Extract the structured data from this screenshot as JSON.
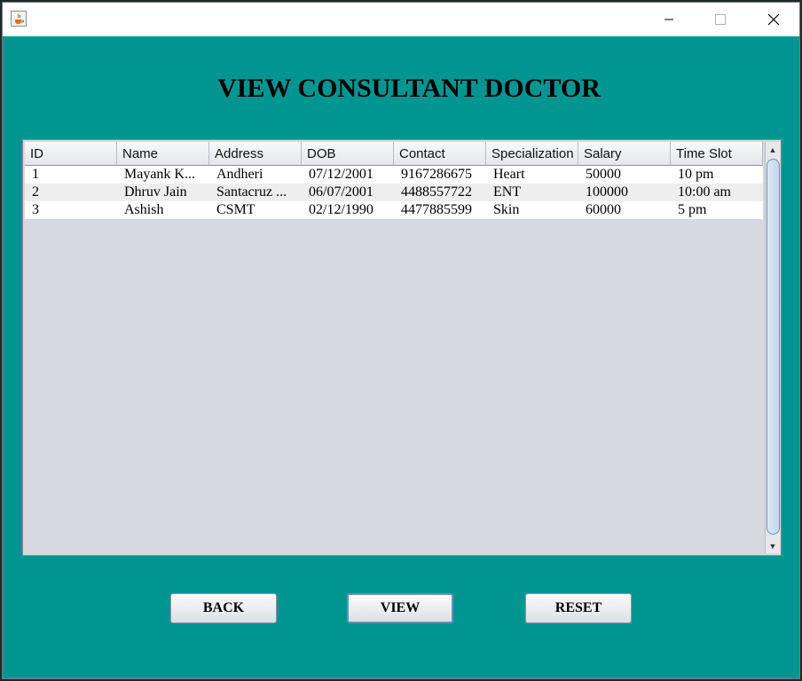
{
  "window": {
    "icons": {
      "app": "java-cup-icon",
      "minimize": "minimize-icon",
      "maximize": "maximize-icon",
      "close": "close-icon"
    }
  },
  "main": {
    "title": "VIEW CONSULTANT DOCTOR"
  },
  "table": {
    "columns": [
      "ID",
      "Name",
      "Address",
      "DOB",
      "Contact",
      "Specialization",
      "Salary",
      "Time Slot"
    ],
    "rows": [
      [
        "1",
        "Mayank K...",
        "Andheri",
        "07/12/2001",
        "9167286675",
        "Heart",
        "50000",
        "10 pm"
      ],
      [
        "2",
        "Dhruv Jain",
        "Santacruz ...",
        "06/07/2001",
        "4488557722",
        "ENT",
        "100000",
        "10:00 am"
      ],
      [
        "3",
        "Ashish",
        "CSMT",
        "02/12/1990",
        "4477885599",
        "Skin",
        "60000",
        "5 pm"
      ]
    ]
  },
  "buttons": {
    "back": "BACK",
    "view": "VIEW",
    "reset": "RESET"
  },
  "colors": {
    "background": "#019592",
    "table_bg": "#d6d9e0"
  }
}
